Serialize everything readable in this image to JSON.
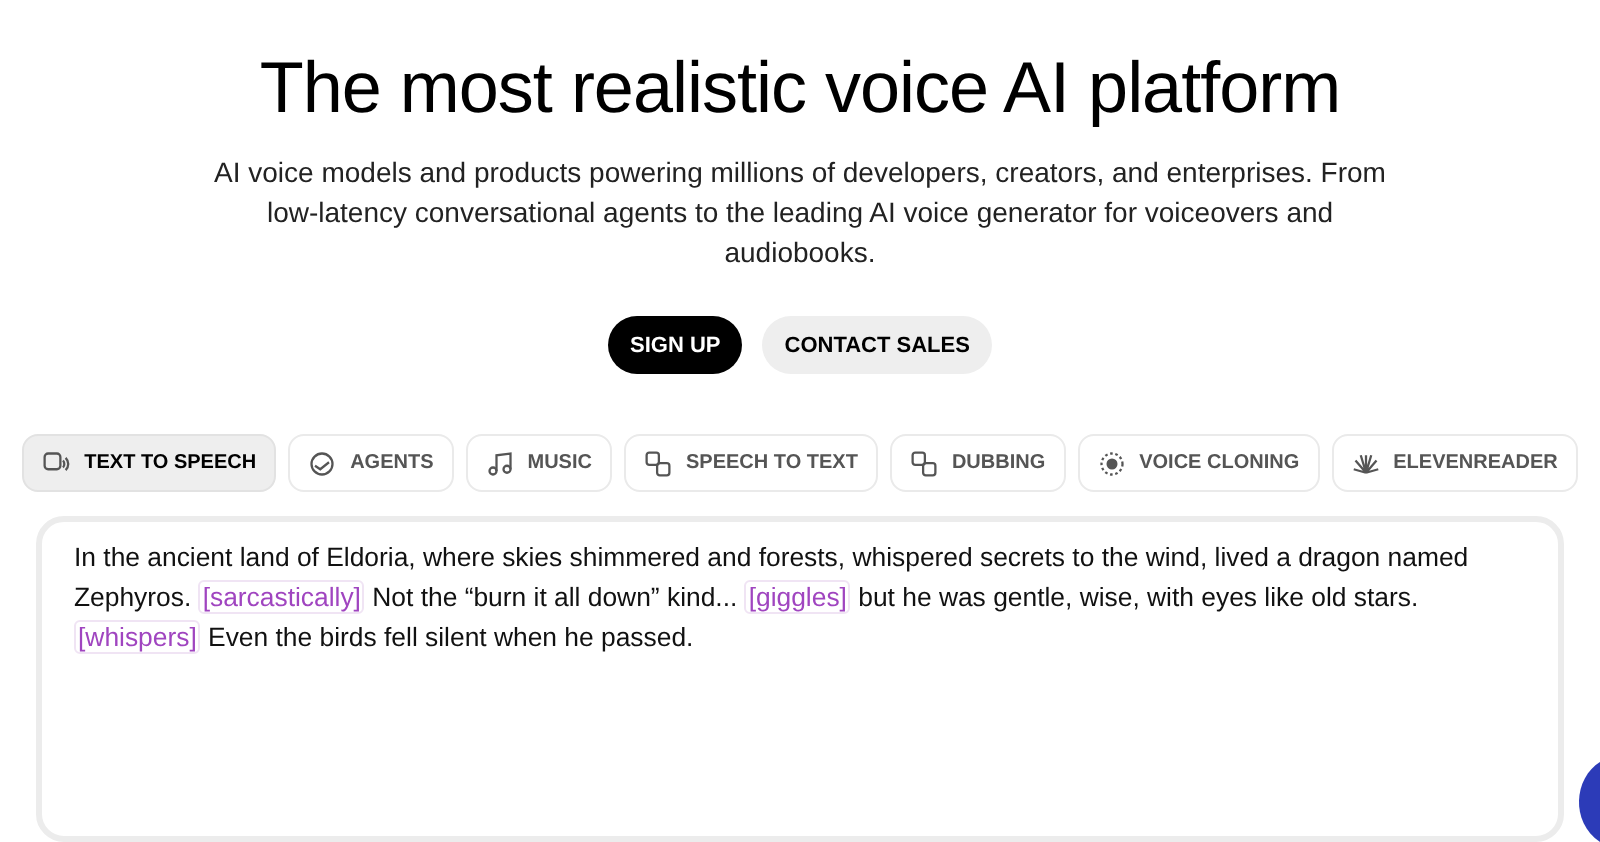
{
  "hero": {
    "title": "The most realistic voice AI platform",
    "subtitle": "AI voice models and products powering millions of developers, creators, and enterprises. From low-latency conversational agents to the leading AI voice generator for voiceovers and audiobooks."
  },
  "buttons": [
    {
      "label": "SIGN UP",
      "kind": "primary"
    },
    {
      "label": "CONTACT SALES",
      "kind": "secondary"
    }
  ],
  "tabs": [
    {
      "label": "TEXT TO SPEECH",
      "selected": true
    },
    {
      "label": "AGENTS",
      "selected": false
    },
    {
      "label": "MUSIC",
      "selected": false
    },
    {
      "label": "SPEECH TO TEXT",
      "selected": false
    },
    {
      "label": "DUBBING",
      "selected": false
    },
    {
      "label": "VOICE CLONING",
      "selected": false
    },
    {
      "label": "ELEVENREADER",
      "selected": false
    }
  ],
  "editor": {
    "segments": [
      {
        "kind": "text",
        "text": "In the ancient land of Eldoria, where skies shimmered and forests, whispered secrets to the wind, lived a dragon named"
      },
      {
        "kind": "text",
        "text": "Zephyros."
      },
      {
        "kind": "tag",
        "text": "[sarcastically]"
      },
      {
        "kind": "text",
        "text": "Not the “burn it all down” kind..."
      },
      {
        "kind": "tag",
        "text": "[giggles]"
      },
      {
        "kind": "text",
        "text": "but he was gentle, wise, with eyes like old stars."
      },
      {
        "kind": "tag",
        "text": "[whispers]"
      },
      {
        "kind": "text",
        "text": "Even the birds fell silent when he passed."
      }
    ]
  }
}
